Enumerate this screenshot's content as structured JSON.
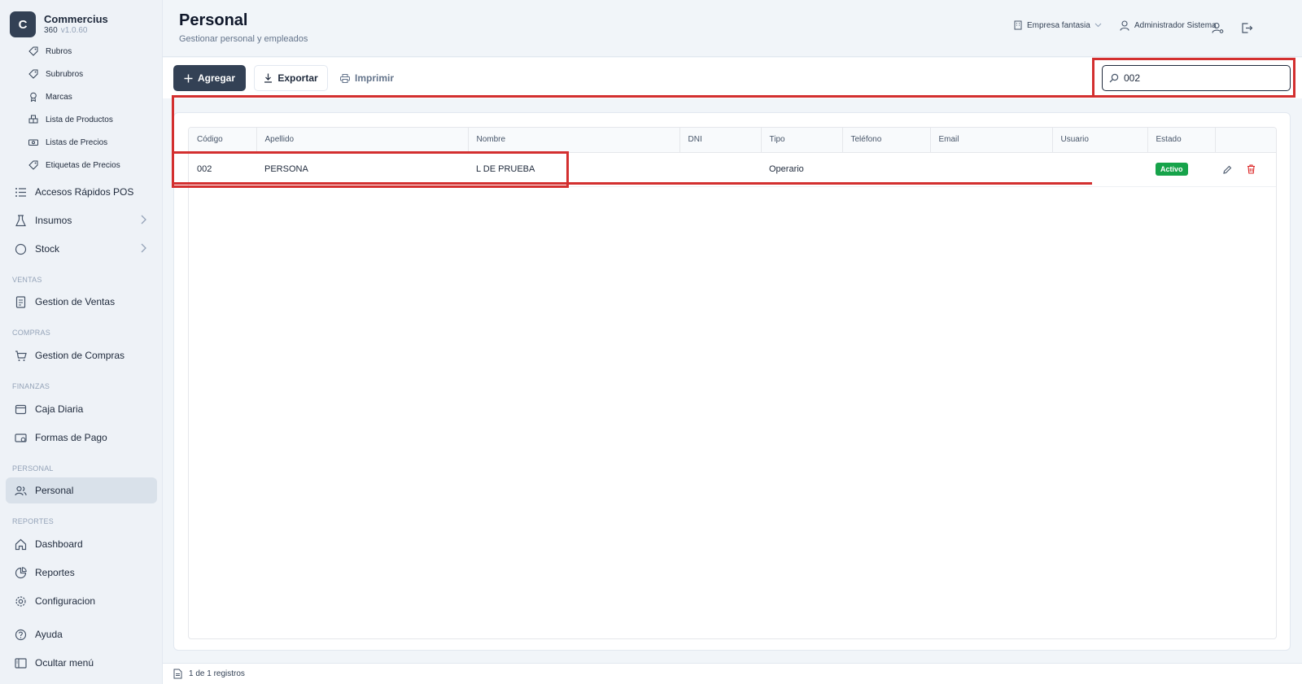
{
  "app": {
    "logo_letter": "C",
    "name": "Commercius",
    "edition": "360",
    "version": "v1.0.60"
  },
  "sidebar": {
    "sub_items": [
      {
        "label": "Rubros",
        "icon": "tag-icon"
      },
      {
        "label": "Subrubros",
        "icon": "tag-icon"
      },
      {
        "label": "Marcas",
        "icon": "award-icon"
      },
      {
        "label": "Lista de Productos",
        "icon": "boxes-icon"
      },
      {
        "label": "Listas de Precios",
        "icon": "banknote-icon"
      },
      {
        "label": "Etiquetas de Precios",
        "icon": "tag-icon"
      }
    ],
    "items": [
      {
        "label": "Accesos Rápidos POS",
        "icon": "list-icon"
      },
      {
        "label": "Insumos",
        "icon": "flask-icon"
      },
      {
        "label": "Stock",
        "icon": "circle-icon"
      },
      {
        "label": "Gestion de Ventas",
        "icon": "receipt-icon"
      },
      {
        "label": "Gestion de Compras",
        "icon": "cart-icon"
      },
      {
        "label": "Caja Diaria",
        "icon": "wallet-icon"
      },
      {
        "label": "Formas de Pago",
        "icon": "credit-card-icon"
      },
      {
        "label": "Personal",
        "icon": "users-icon"
      },
      {
        "label": "Dashboard",
        "icon": "home-icon"
      },
      {
        "label": "Reportes",
        "icon": "chart-icon"
      },
      {
        "label": "Configuracion",
        "icon": "gear-icon"
      },
      {
        "label": "Ayuda",
        "icon": "help-icon"
      },
      {
        "label": "Ocultar menú",
        "icon": "panel-icon"
      }
    ],
    "sections": [
      "VENTAS",
      "COMPRAS",
      "FINANZAS",
      "PERSONAL",
      "REPORTES"
    ],
    "active_item": "Personal"
  },
  "header": {
    "title": "Personal",
    "subtitle": "Gestionar personal y empleados",
    "company": "Empresa fantasia",
    "user": "Administrador Sistema"
  },
  "toolbar": {
    "add_label": "Agregar",
    "export_label": "Exportar",
    "print_label": "Imprimir",
    "search_value": "002"
  },
  "table": {
    "columns": [
      "Código",
      "Apellido",
      "Nombre",
      "DNI",
      "Tipo",
      "Teléfono",
      "Email",
      "Usuario",
      "Estado",
      ""
    ],
    "rows": [
      {
        "codigo": "002",
        "apellido": "PERSONA",
        "nombre": "L DE PRUEBA",
        "dni": "",
        "tipo": "Operario",
        "telefono": "",
        "email": "",
        "usuario": "",
        "estado": "Activo"
      }
    ]
  },
  "footer": {
    "records": "1 de 1 registros"
  },
  "colors": {
    "primary": "#334155",
    "active_badge": "#16a34a",
    "delete": "#dc2626",
    "annotation": "#d32f2f"
  }
}
